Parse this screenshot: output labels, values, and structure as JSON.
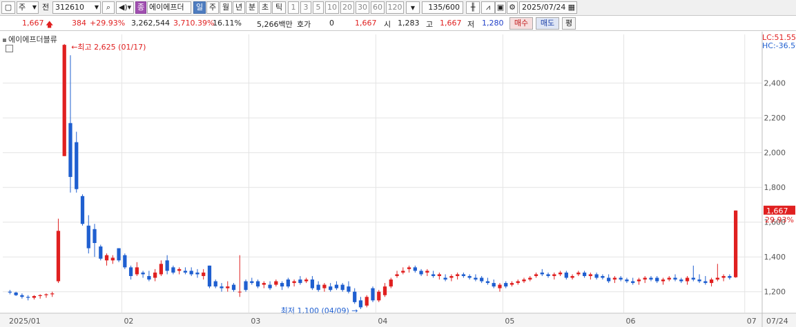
{
  "toolbar": {
    "period_select": "주",
    "jeon_label": "전",
    "code": "312610",
    "stock_badge": "종",
    "stock_name": "에이에프더",
    "tf_day": "일",
    "tf_week": "주",
    "tf_month": "월",
    "tf_year": "년",
    "tf_min": "분",
    "tf_sec": "초",
    "tf_tick": "틱",
    "intervals": [
      "1",
      "3",
      "5",
      "10",
      "20",
      "30",
      "60",
      "120"
    ],
    "bar_count": "135",
    "bar_total": "/600",
    "date": "2025/07/24"
  },
  "quote": {
    "price": "1,667",
    "change": "384",
    "change_pct": "+29.93%",
    "volume": "3,262,544",
    "volume_ratio": "3,710.39%",
    "turnover": "16.11%",
    "amount": "5,266백만",
    "hoga_label": "호가",
    "hoga_value": "0",
    "hoga_price": "1,667",
    "open_label": "시",
    "open": "1,283",
    "high_label": "고",
    "high": "1,667",
    "low_label": "저",
    "low": "1,280",
    "buy_label": "매수",
    "sell_label": "매도",
    "eval_label": "평"
  },
  "chart_legend": "에이에프더블류",
  "right_labels": {
    "lc": "LC:51.55",
    "hc": "HC:-36.50",
    "last_price": "1,667",
    "last_pct": "29.93%"
  },
  "colors": {
    "up": "#e02020",
    "down": "#1f5fd0",
    "grid": "#e4e4e4",
    "price_tag": "#e02020",
    "hc": "#1f5fd0"
  },
  "chart_data": {
    "type": "candlestick",
    "ylim": [
      1080,
      2680
    ],
    "yticks": [
      1200,
      1400,
      1600,
      1800,
      2000,
      2200,
      2400
    ],
    "ytick_labels": [
      "1,200",
      "1,400",
      "1,600",
      "1,800",
      "2,000",
      "2,200",
      "2,400"
    ],
    "x_labels": [
      "2025/01",
      "02",
      "03",
      "04",
      "05",
      "06",
      "07"
    ],
    "x_label_index": [
      0,
      19,
      40,
      61,
      82,
      102,
      122
    ],
    "end_date": "07/24",
    "high_annotation": "최고 2,625 (01/17)",
    "low_annotation": "최저 1,100 (04/09)",
    "candles": [
      [
        1200,
        1210,
        1185,
        1195
      ],
      [
        1195,
        1200,
        1175,
        1180
      ],
      [
        1180,
        1190,
        1160,
        1170
      ],
      [
        1170,
        1180,
        1150,
        1165
      ],
      [
        1165,
        1180,
        1155,
        1175
      ],
      [
        1175,
        1185,
        1160,
        1180
      ],
      [
        1180,
        1190,
        1165,
        1185
      ],
      [
        1185,
        1200,
        1170,
        1190
      ],
      [
        1260,
        1620,
        1250,
        1550
      ],
      [
        1980,
        2625,
        1980,
        2620
      ],
      [
        2170,
        2560,
        1770,
        1860
      ],
      [
        2060,
        2120,
        1770,
        1790
      ],
      [
        1750,
        1760,
        1580,
        1590
      ],
      [
        1580,
        1640,
        1420,
        1450
      ],
      [
        1560,
        1590,
        1400,
        1480
      ],
      [
        1460,
        1470,
        1380,
        1390
      ],
      [
        1380,
        1420,
        1350,
        1410
      ],
      [
        1380,
        1410,
        1360,
        1395
      ],
      [
        1450,
        1450,
        1370,
        1380
      ],
      [
        1410,
        1420,
        1330,
        1340
      ],
      [
        1340,
        1350,
        1270,
        1290
      ],
      [
        1300,
        1370,
        1290,
        1340
      ],
      [
        1310,
        1320,
        1280,
        1300
      ],
      [
        1290,
        1320,
        1260,
        1270
      ],
      [
        1280,
        1330,
        1260,
        1310
      ],
      [
        1300,
        1380,
        1290,
        1360
      ],
      [
        1380,
        1410,
        1300,
        1320
      ],
      [
        1340,
        1350,
        1300,
        1310
      ],
      [
        1320,
        1340,
        1300,
        1330
      ],
      [
        1320,
        1340,
        1300,
        1310
      ],
      [
        1320,
        1340,
        1290,
        1300
      ],
      [
        1310,
        1330,
        1280,
        1300
      ],
      [
        1290,
        1330,
        1270,
        1310
      ],
      [
        1350,
        1350,
        1220,
        1230
      ],
      [
        1260,
        1270,
        1220,
        1230
      ],
      [
        1230,
        1250,
        1200,
        1220
      ],
      [
        1220,
        1260,
        1200,
        1230
      ],
      [
        1240,
        1250,
        1200,
        1210
      ],
      [
        1200,
        1410,
        1170,
        1200
      ],
      [
        1260,
        1270,
        1200,
        1210
      ],
      [
        1260,
        1280,
        1240,
        1250
      ],
      [
        1260,
        1270,
        1220,
        1230
      ],
      [
        1240,
        1260,
        1220,
        1250
      ],
      [
        1240,
        1260,
        1210,
        1220
      ],
      [
        1240,
        1270,
        1230,
        1260
      ],
      [
        1250,
        1260,
        1210,
        1230
      ],
      [
        1270,
        1280,
        1220,
        1230
      ],
      [
        1250,
        1270,
        1230,
        1260
      ],
      [
        1270,
        1290,
        1240,
        1250
      ],
      [
        1260,
        1280,
        1250,
        1270
      ],
      [
        1270,
        1290,
        1210,
        1220
      ],
      [
        1240,
        1260,
        1200,
        1210
      ],
      [
        1220,
        1250,
        1200,
        1240
      ],
      [
        1230,
        1250,
        1200,
        1210
      ],
      [
        1240,
        1260,
        1210,
        1220
      ],
      [
        1240,
        1250,
        1200,
        1210
      ],
      [
        1230,
        1260,
        1190,
        1200
      ],
      [
        1200,
        1220,
        1130,
        1140
      ],
      [
        1150,
        1170,
        1100,
        1110
      ],
      [
        1120,
        1180,
        1110,
        1170
      ],
      [
        1220,
        1230,
        1140,
        1150
      ],
      [
        1150,
        1210,
        1140,
        1200
      ],
      [
        1180,
        1250,
        1170,
        1230
      ],
      [
        1230,
        1280,
        1220,
        1270
      ],
      [
        1290,
        1320,
        1280,
        1300
      ],
      [
        1310,
        1340,
        1300,
        1320
      ],
      [
        1330,
        1350,
        1310,
        1340
      ],
      [
        1340,
        1350,
        1310,
        1320
      ],
      [
        1320,
        1330,
        1290,
        1300
      ],
      [
        1310,
        1330,
        1290,
        1320
      ],
      [
        1300,
        1320,
        1280,
        1290
      ],
      [
        1290,
        1310,
        1270,
        1300
      ],
      [
        1280,
        1300,
        1260,
        1270
      ],
      [
        1280,
        1300,
        1260,
        1290
      ],
      [
        1290,
        1310,
        1270,
        1300
      ],
      [
        1300,
        1310,
        1280,
        1290
      ],
      [
        1290,
        1300,
        1270,
        1280
      ],
      [
        1280,
        1300,
        1260,
        1270
      ],
      [
        1280,
        1290,
        1250,
        1260
      ],
      [
        1260,
        1280,
        1240,
        1250
      ],
      [
        1250,
        1270,
        1220,
        1230
      ],
      [
        1220,
        1250,
        1200,
        1240
      ],
      [
        1250,
        1260,
        1220,
        1230
      ],
      [
        1240,
        1260,
        1230,
        1250
      ],
      [
        1250,
        1270,
        1240,
        1260
      ],
      [
        1260,
        1280,
        1250,
        1270
      ],
      [
        1270,
        1290,
        1260,
        1280
      ],
      [
        1290,
        1310,
        1280,
        1300
      ],
      [
        1310,
        1330,
        1290,
        1300
      ],
      [
        1300,
        1310,
        1280,
        1290
      ],
      [
        1290,
        1310,
        1270,
        1300
      ],
      [
        1300,
        1320,
        1290,
        1310
      ],
      [
        1310,
        1320,
        1270,
        1280
      ],
      [
        1280,
        1300,
        1270,
        1290
      ],
      [
        1300,
        1320,
        1290,
        1310
      ],
      [
        1310,
        1320,
        1280,
        1290
      ],
      [
        1290,
        1310,
        1270,
        1300
      ],
      [
        1300,
        1310,
        1270,
        1280
      ],
      [
        1290,
        1300,
        1270,
        1280
      ],
      [
        1280,
        1300,
        1250,
        1260
      ],
      [
        1270,
        1290,
        1250,
        1280
      ],
      [
        1280,
        1290,
        1260,
        1270
      ],
      [
        1270,
        1280,
        1250,
        1260
      ],
      [
        1260,
        1280,
        1240,
        1250
      ],
      [
        1260,
        1280,
        1240,
        1270
      ],
      [
        1270,
        1290,
        1250,
        1280
      ],
      [
        1280,
        1290,
        1260,
        1270
      ],
      [
        1280,
        1290,
        1250,
        1260
      ],
      [
        1260,
        1280,
        1240,
        1270
      ],
      [
        1270,
        1290,
        1260,
        1280
      ],
      [
        1280,
        1300,
        1260,
        1270
      ],
      [
        1270,
        1280,
        1250,
        1260
      ],
      [
        1260,
        1290,
        1240,
        1280
      ],
      [
        1280,
        1350,
        1260,
        1270
      ],
      [
        1270,
        1300,
        1250,
        1260
      ],
      [
        1260,
        1290,
        1240,
        1250
      ],
      [
        1250,
        1280,
        1230,
        1270
      ],
      [
        1270,
        1360,
        1260,
        1280
      ],
      [
        1280,
        1300,
        1260,
        1290
      ],
      [
        1290,
        1300,
        1270,
        1280
      ],
      [
        1283,
        1667,
        1280,
        1667
      ]
    ]
  }
}
